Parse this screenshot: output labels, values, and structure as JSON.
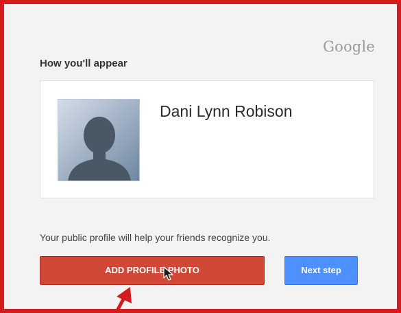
{
  "brand": {
    "logo_text": "Google"
  },
  "heading": "How you'll appear",
  "profile": {
    "name": "Dani Lynn Robison",
    "avatar_icon": "default-person-silhouette"
  },
  "hint_text": "Your public profile will help your friends recognize you.",
  "buttons": {
    "add_photo_label": "ADD PROFILE PHOTO",
    "next_label": "Next step"
  },
  "colors": {
    "frame_border": "#d41c1c",
    "add_photo_button": "#d14836",
    "next_button": "#4d90fe",
    "panel_background": "#f3f3f3"
  },
  "icons": {
    "cursor": "mouse-pointer-icon",
    "annotation": "red-arrow-icon"
  }
}
